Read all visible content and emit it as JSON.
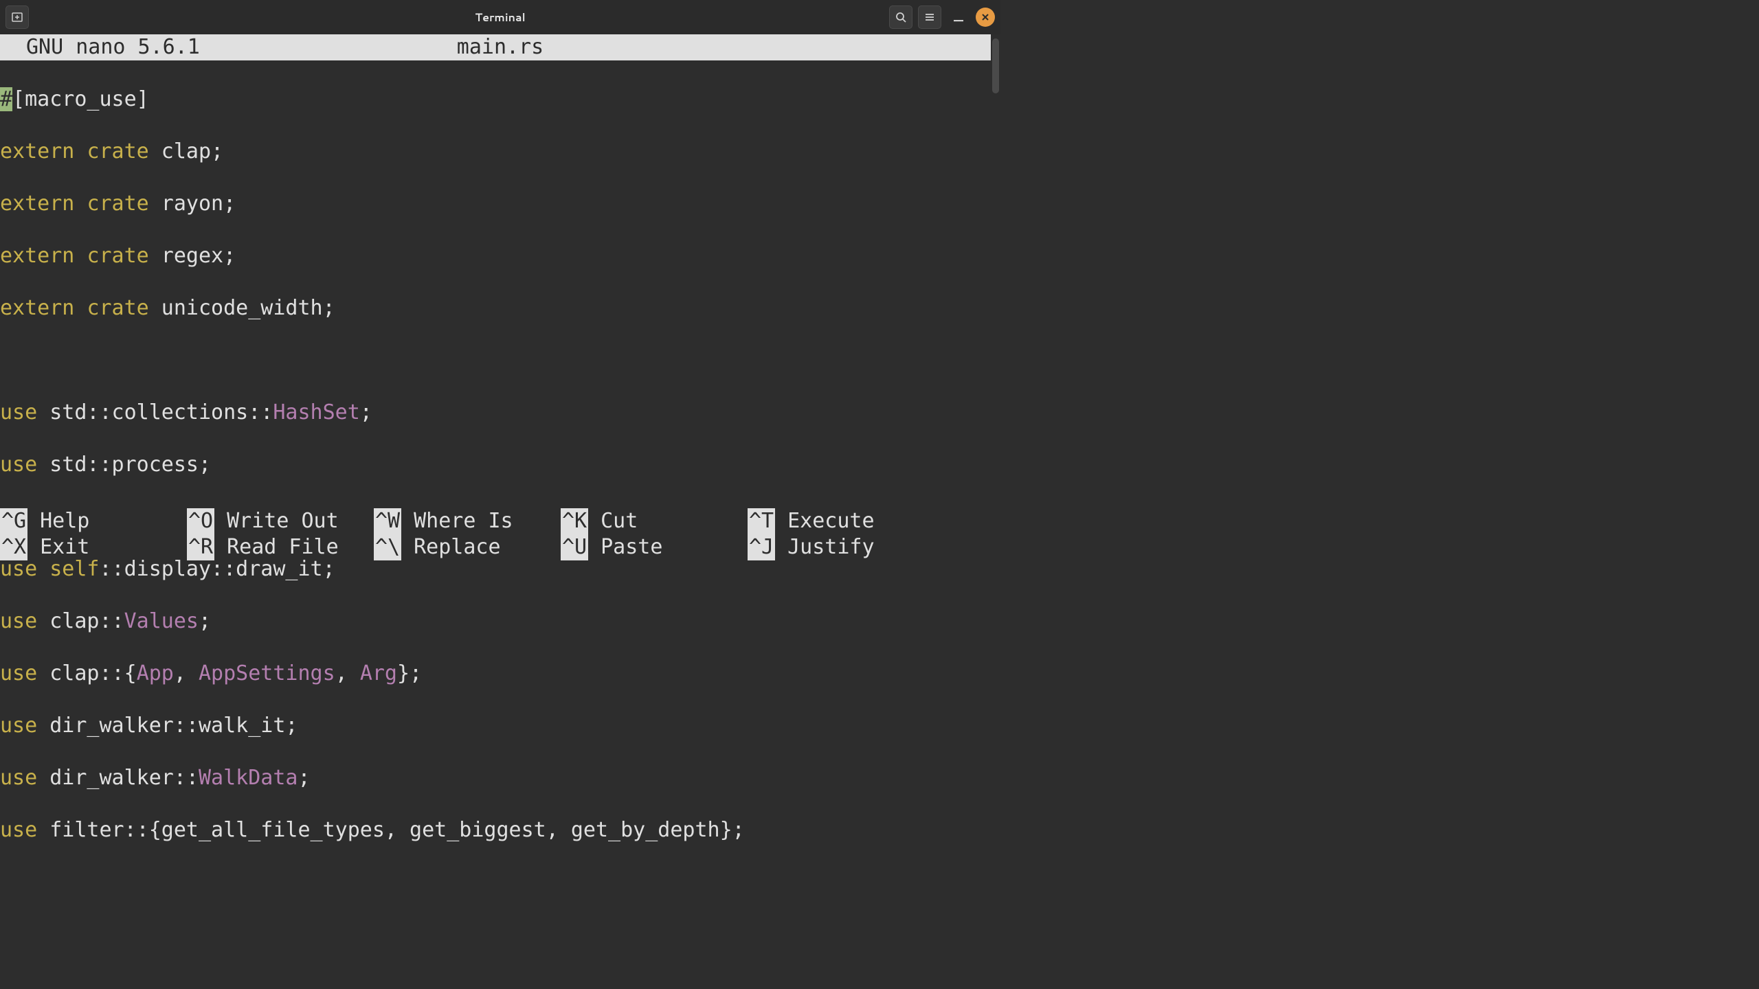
{
  "titlebar": {
    "title": "Terminal"
  },
  "nano": {
    "app_line": "GNU  nano 5.6.1",
    "filename": "main.rs"
  },
  "code": {
    "l1a": "#",
    "l1b": "[macro_use]",
    "l2a": "extern",
    "l2b": " ",
    "l2c": "crate",
    "l2d": " clap;",
    "l3a": "extern",
    "l3c": "crate",
    "l3d": " rayon;",
    "l4a": "extern",
    "l4c": "crate",
    "l4d": " regex;",
    "l5a": "extern",
    "l5c": "crate",
    "l5d": " unicode_width;",
    "l7a": "use",
    "l7b": " std::collections::",
    "l7c": "HashSet",
    "l7d": ";",
    "l8a": "use",
    "l8b": " std::process;",
    "l10a": "use",
    "l10b": " ",
    "l10c": "self",
    "l10d": "::display::draw_it;",
    "l11a": "use",
    "l11b": " clap::",
    "l11c": "Values",
    "l11d": ";",
    "l12a": "use",
    "l12b": " clap::{",
    "l12c": "App",
    "l12d": ", ",
    "l12e": "AppSettings",
    "l12f": ", ",
    "l12g": "Arg",
    "l12h": "};",
    "l13a": "use",
    "l13b": " dir_walker::walk_it;",
    "l14a": "use",
    "l14b": " dir_walker::",
    "l14c": "WalkData",
    "l14d": ";",
    "l15a": "use",
    "l15b": " filter::{get_all_file_types, get_biggest, get_by_depth};"
  },
  "shortcuts": {
    "r1c1k": "^G",
    "r1c1l": "Help",
    "r1c2k": "^O",
    "r1c2l": "Write Out",
    "r1c3k": "^W",
    "r1c3l": "Where Is",
    "r1c4k": "^K",
    "r1c4l": "Cut",
    "r1c5k": "^T",
    "r1c5l": "Execute",
    "r2c1k": "^X",
    "r2c1l": "Exit",
    "r2c2k": "^R",
    "r2c2l": "Read File",
    "r2c3k": "^\\",
    "r2c3l": "Replace",
    "r2c4k": "^U",
    "r2c4l": "Paste",
    "r2c5k": "^J",
    "r2c5l": "Justify"
  }
}
